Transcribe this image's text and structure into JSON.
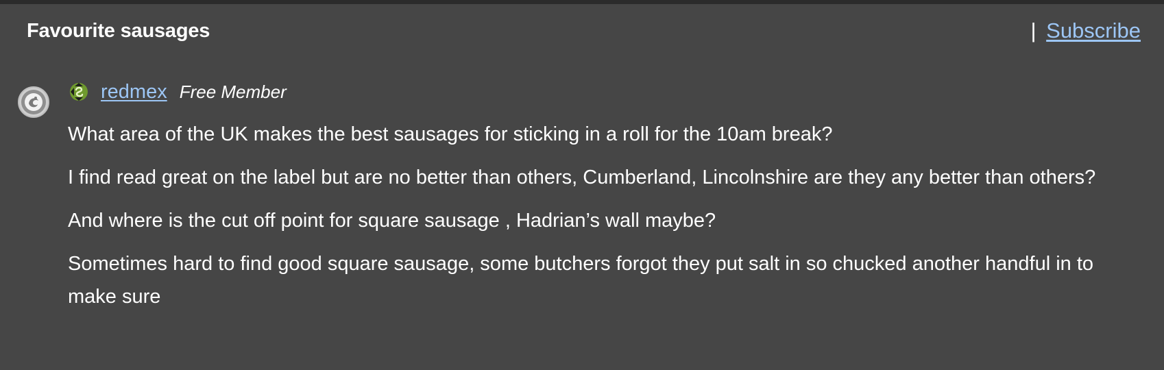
{
  "thread": {
    "title": "Favourite sausages",
    "subscribe_separator": "|",
    "subscribe_label": "Subscribe"
  },
  "post": {
    "author": "redmex",
    "role": "Free Member",
    "paragraphs": [
      "What area of the UK makes the best sausages for sticking in a roll for the 10am break?",
      "I find read great on the label but are no better than others, Cumberland, Lincolnshire are they any better than others?",
      "And where is the cut off point for square sausage , Hadrian’s wall maybe?",
      "Sometimes hard to find good square sausage, some butchers forgot they put salt in so chucked another handful in to make sure"
    ]
  },
  "icons": {
    "avatar": "user-avatar-icon",
    "badge": "member-badge-icon"
  },
  "colors": {
    "background": "#464646",
    "link": "#9dc6f5",
    "text": "#ffffff"
  }
}
